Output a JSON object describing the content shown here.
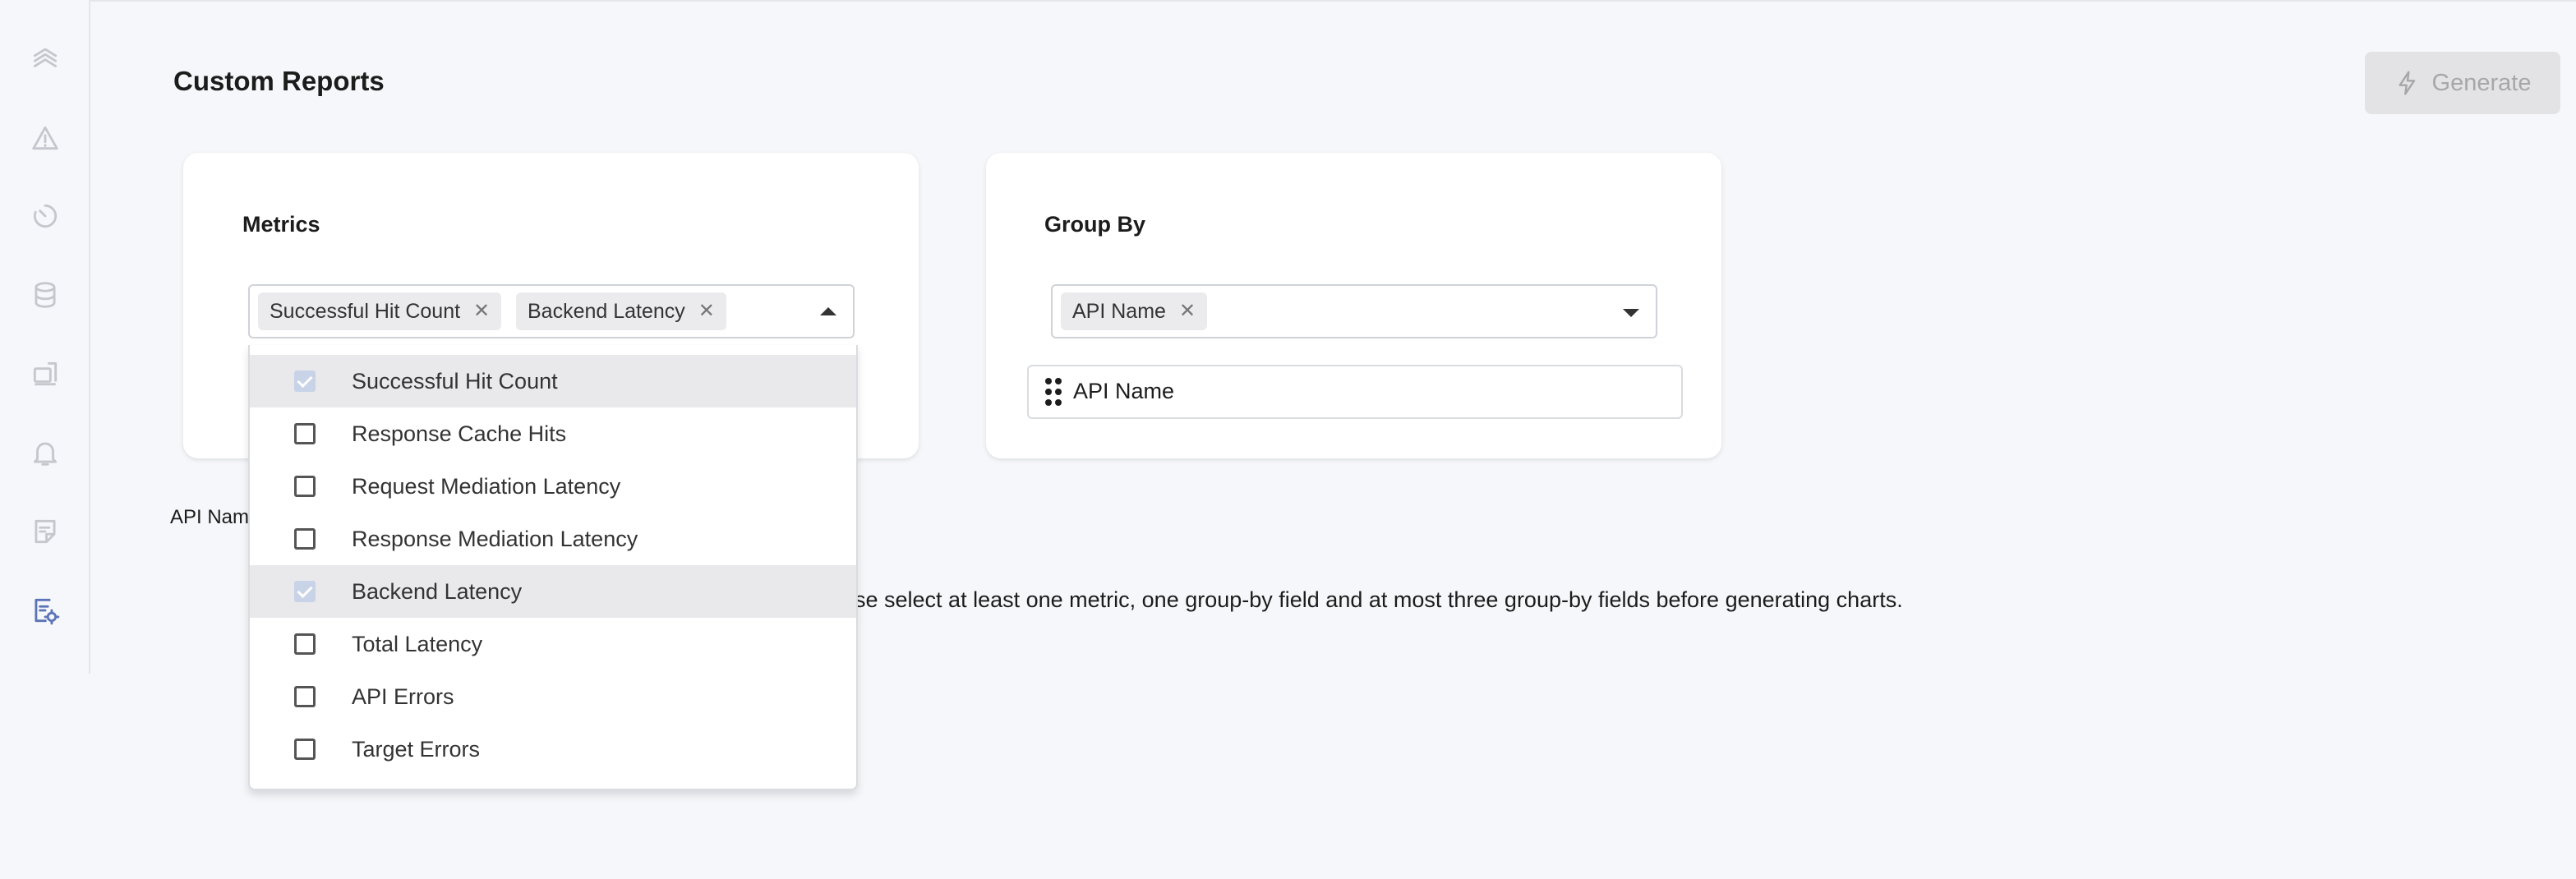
{
  "sidebar": {
    "items": [
      {
        "icon": "layers-icon",
        "active": false
      },
      {
        "icon": "warning-icon",
        "active": false
      },
      {
        "icon": "timer-icon",
        "active": false
      },
      {
        "icon": "database-icon",
        "active": false
      },
      {
        "icon": "device-icon",
        "active": false
      },
      {
        "icon": "bell-icon",
        "active": false
      },
      {
        "icon": "note-icon",
        "active": false
      },
      {
        "icon": "report-settings-icon",
        "active": true
      }
    ]
  },
  "header": {
    "title": "Custom Reports",
    "generate_label": "Generate"
  },
  "metrics": {
    "title": "Metrics",
    "chips": [
      "Successful Hit Count",
      "Backend Latency"
    ],
    "options": [
      {
        "label": "Successful Hit Count",
        "checked": true
      },
      {
        "label": "Response Cache Hits",
        "checked": false
      },
      {
        "label": "Request Mediation Latency",
        "checked": false
      },
      {
        "label": "Response Mediation Latency",
        "checked": false
      },
      {
        "label": "Backend Latency",
        "checked": true
      },
      {
        "label": "Total Latency",
        "checked": false
      },
      {
        "label": "API Errors",
        "checked": false
      },
      {
        "label": "Target Errors",
        "checked": false
      }
    ]
  },
  "group_by": {
    "title": "Group By",
    "chips": [
      "API Name"
    ],
    "rows": [
      "API Name"
    ]
  },
  "selected_group_label": "API Nam",
  "info_text": "se select at least one metric, one group-by field and at most three group-by fields before generating charts.",
  "colors": {
    "background": "#f6f7fa",
    "active_icon": "#5b74b8",
    "inactive_icon": "#c4c7cd",
    "disabled_button": "#e3e3e6"
  }
}
